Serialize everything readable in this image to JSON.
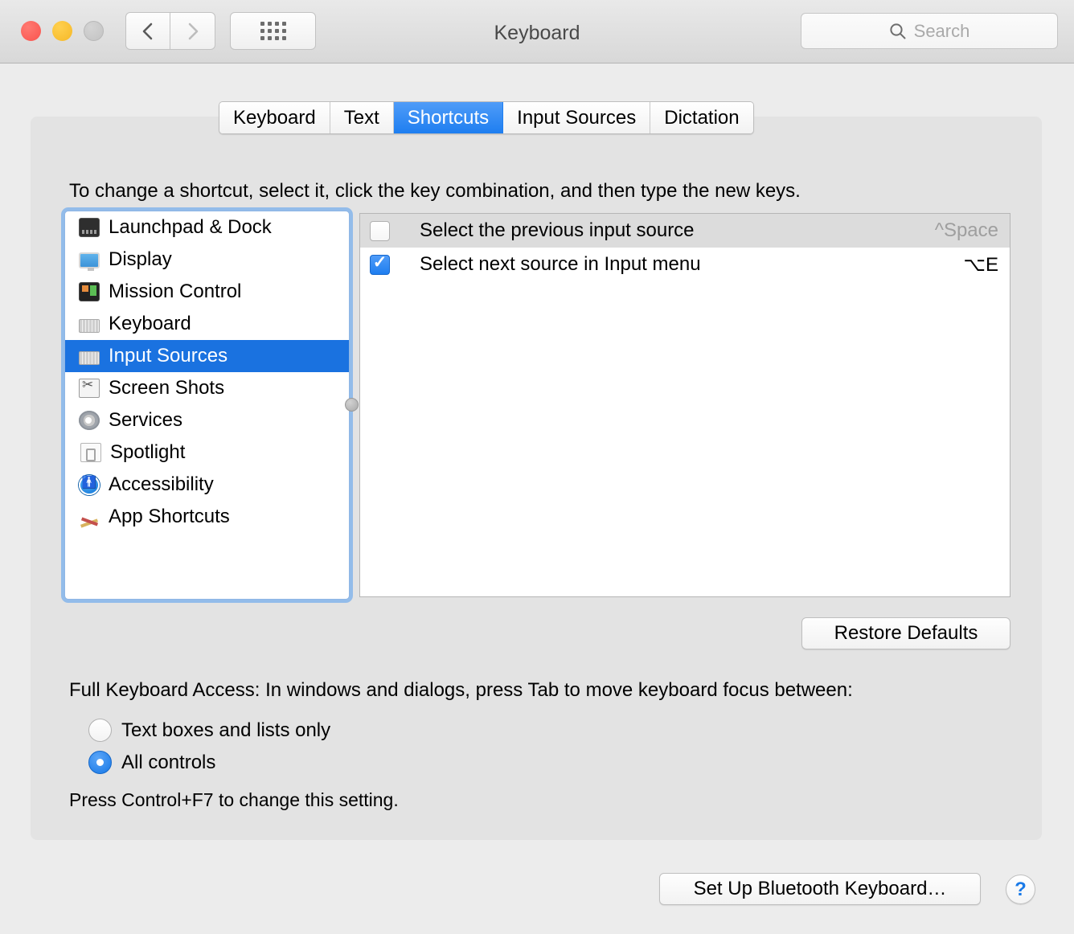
{
  "window": {
    "title": "Keyboard",
    "traffic_lights": [
      "close",
      "minimize",
      "zoom"
    ],
    "nav_back_icon": "chevron-left-icon",
    "nav_forward_icon": "chevron-right-icon",
    "show_all_icon": "grid-dots-icon"
  },
  "search": {
    "placeholder": "Search",
    "value": "",
    "icon": "search-icon"
  },
  "tabs": [
    {
      "label": "Keyboard",
      "active": false
    },
    {
      "label": "Text",
      "active": false
    },
    {
      "label": "Shortcuts",
      "active": true
    },
    {
      "label": "Input Sources",
      "active": false
    },
    {
      "label": "Dictation",
      "active": false
    }
  ],
  "instruction": "To change a shortcut, select it, click the key combination, and then type the new keys.",
  "sidebar": {
    "items": [
      {
        "label": "Launchpad & Dock",
        "icon": "launchpad-dock-icon",
        "selected": false
      },
      {
        "label": "Display",
        "icon": "display-icon",
        "selected": false
      },
      {
        "label": "Mission Control",
        "icon": "mission-control-icon",
        "selected": false
      },
      {
        "label": "Keyboard",
        "icon": "keyboard-icon",
        "selected": false
      },
      {
        "label": "Input Sources",
        "icon": "input-sources-icon",
        "selected": true
      },
      {
        "label": "Screen Shots",
        "icon": "screenshot-icon",
        "selected": false
      },
      {
        "label": "Services",
        "icon": "gear-icon",
        "selected": false
      },
      {
        "label": "Spotlight",
        "icon": "spotlight-icon",
        "selected": false
      },
      {
        "label": "Accessibility",
        "icon": "accessibility-icon",
        "selected": false
      },
      {
        "label": "App Shortcuts",
        "icon": "app-shortcuts-icon",
        "selected": false
      }
    ]
  },
  "shortcuts": {
    "rows": [
      {
        "name": "Select the previous input source",
        "key": "^Space",
        "checked": false
      },
      {
        "name": "Select next source in Input menu",
        "key": "⌥E",
        "checked": true
      }
    ]
  },
  "buttons": {
    "restore_defaults": "Restore Defaults",
    "bluetooth_keyboard": "Set Up Bluetooth Keyboard…",
    "help": "?"
  },
  "full_keyboard_access": {
    "label": "Full Keyboard Access: In windows and dialogs, press Tab to move keyboard focus between:",
    "options": [
      {
        "label": "Text boxes and lists only",
        "selected": false
      },
      {
        "label": "All controls",
        "selected": true
      }
    ],
    "note": "Press Control+F7 to change this setting."
  },
  "colors": {
    "accent_blue": "#1e7ef0",
    "selection_blue": "#1a72e0",
    "help_blue": "#1a7ae8",
    "window_bg": "#ececec",
    "panel_bg": "#e3e3e3"
  }
}
